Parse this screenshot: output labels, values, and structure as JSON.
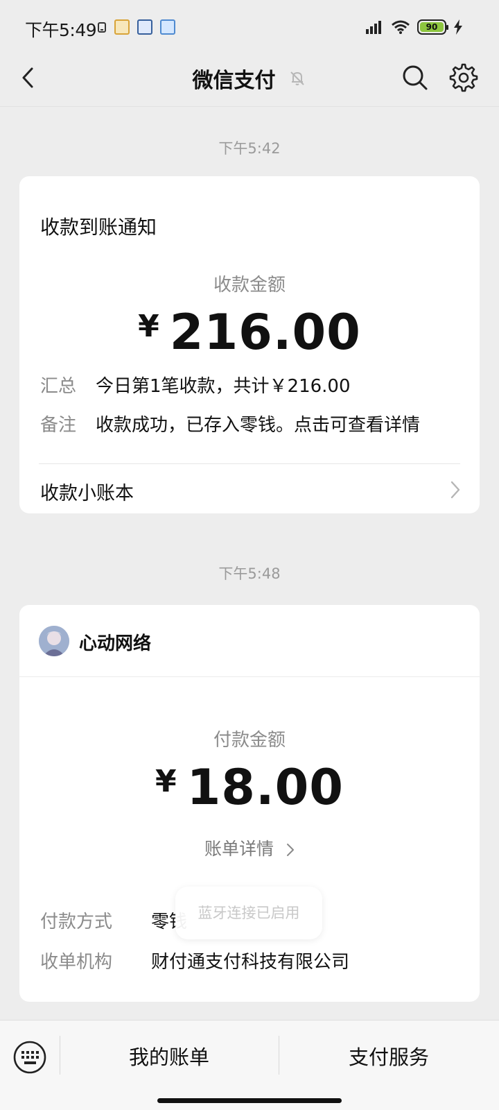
{
  "status_bar": {
    "time": "下午5:49",
    "battery": "90"
  },
  "nav": {
    "title": "微信支付"
  },
  "messages": [
    {
      "timestamp": "下午5:42",
      "card_title": "收款到账通知",
      "amount_label": "收款金额",
      "currency_symbol": "¥",
      "amount": "216.00",
      "rows": [
        {
          "label": "汇总",
          "value": "今日第1笔收款，共计￥216.00"
        },
        {
          "label": "备注",
          "value": "收款成功，已存入零钱。点击可查看详情"
        }
      ],
      "link_label": "收款小账本"
    },
    {
      "timestamp": "下午5:48",
      "merchant": "心动网络",
      "amount_label": "付款金额",
      "currency_symbol": "¥",
      "amount": "18.00",
      "bill_link": "账单详情",
      "rows": [
        {
          "label": "付款方式",
          "value": "零钱"
        },
        {
          "label": "收单机构",
          "value": "财付通支付科技有限公司"
        }
      ]
    }
  ],
  "toast": "蓝牙连接已启用",
  "bottom_bar": {
    "items": [
      "我的账单",
      "支付服务"
    ]
  },
  "colors": {
    "background": "#ededed",
    "card": "#ffffff",
    "muted_text": "#8b8b8b",
    "battery_fill": "#8dc63f"
  }
}
